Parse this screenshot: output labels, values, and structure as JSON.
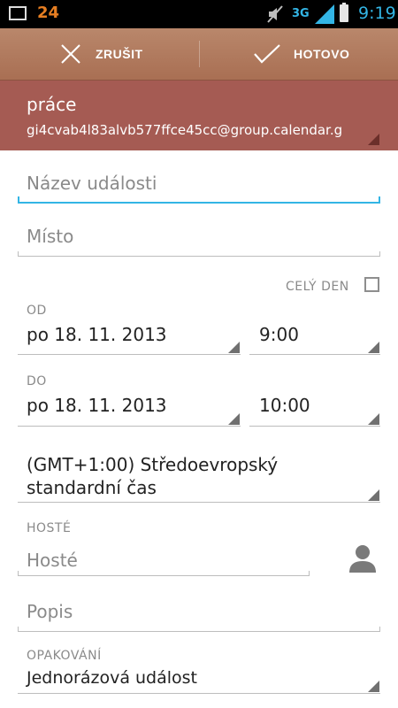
{
  "status_bar": {
    "notification_count": "24",
    "network_type": "3G",
    "time": "9:19",
    "accent": "#33b5e5"
  },
  "action_bar": {
    "cancel_label": "ZRUŠIT",
    "done_label": "HOTOVO",
    "bg_color": "#a96f53"
  },
  "calendar": {
    "name": "práce",
    "account": "gi4cvab4l83alvb577ffce45cc@group.calendar.g",
    "bg_color": "#a55b53"
  },
  "form": {
    "title_placeholder": "Název události",
    "location_placeholder": "Místo",
    "all_day_label": "CELÝ DEN",
    "all_day_checked": false,
    "from_label": "OD",
    "from_date": "po 18. 11. 2013",
    "from_time": "9:00",
    "to_label": "DO",
    "to_date": "po 18. 11. 2013",
    "to_time": "10:00",
    "timezone_line1": "(GMT+1:00) Středoevropský",
    "timezone_line2": "standardní čas",
    "guests_label": "HOSTÉ",
    "guests_placeholder": "Hosté",
    "description_placeholder": "Popis",
    "repeat_label": "OPAKOVÁNÍ",
    "repeat_value": "Jednorázová událost"
  }
}
